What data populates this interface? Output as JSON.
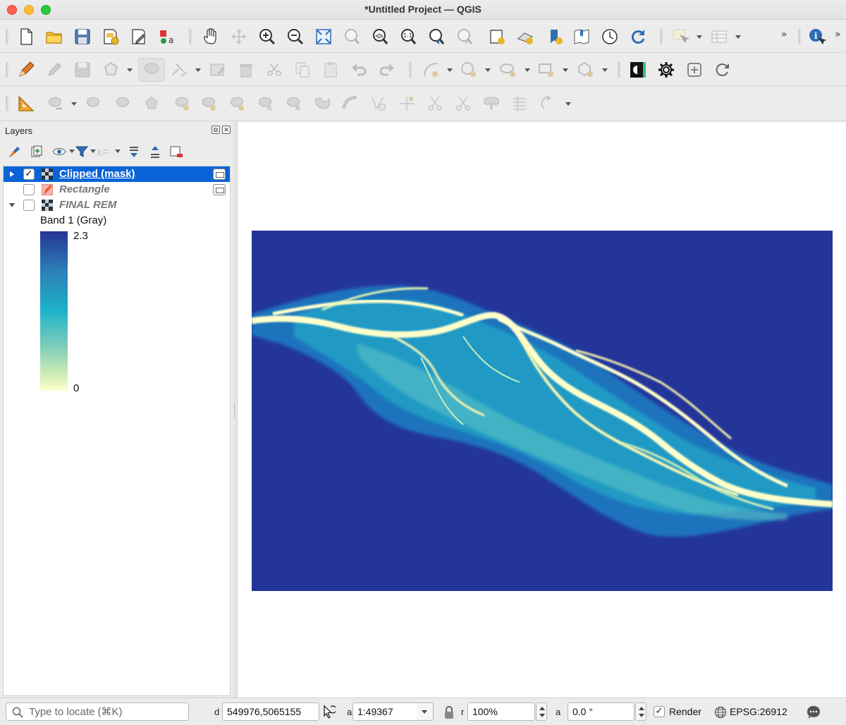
{
  "window": {
    "title": "*Untitled Project — QGIS"
  },
  "toolbars": {
    "overflow_label": "»",
    "icons": [
      "new-project-icon",
      "open-project-icon",
      "save-project-icon",
      "new-print-layout-icon",
      "layout-manager-icon",
      "style-manager-icon",
      "pan-icon",
      "pan-to-selection-icon",
      "zoom-in-icon",
      "zoom-out-icon",
      "zoom-full-icon",
      "zoom-to-selection-icon",
      "zoom-to-layer-icon",
      "zoom-native-icon",
      "zoom-last-icon",
      "zoom-next-icon",
      "new-map-view-icon",
      "new-3d-view-icon",
      "new-bookmark-icon",
      "show-bookmarks-icon",
      "temporal-controller-icon",
      "refresh-icon",
      "select-features-icon",
      "attribute-table-icon",
      "identify-icon"
    ]
  },
  "layers_panel": {
    "title": "Layers",
    "layers": [
      {
        "name": "Clipped (mask)",
        "checked": true,
        "selected": true,
        "expanded": false,
        "check_mark": "✓"
      },
      {
        "name": "Rectangle",
        "checked": false,
        "selected": false,
        "expanded": false,
        "check_mark": ""
      },
      {
        "name": "FINAL REM",
        "checked": false,
        "selected": false,
        "expanded": true,
        "check_mark": ""
      }
    ],
    "legend": {
      "band_label": "Band 1 (Gray)",
      "max": "2.3",
      "min": "0",
      "colors": [
        "#253494",
        "#2c7fb8",
        "#1db3c9",
        "#7fcdbb",
        "#c7e9b4",
        "#ffffcc"
      ]
    }
  },
  "map": {
    "background": "#ffffff",
    "raster_bg": "#24359a",
    "channel_color": "#ffffcc"
  },
  "statusbar": {
    "locator_placeholder": "Type to locate (⌘K)",
    "coordinate_label": "d",
    "coordinate": "549976,5065155",
    "scale_label": "a",
    "scale": "1:49367",
    "magnifier_label": "r",
    "magnifier": "100%",
    "rotation_label": "a",
    "rotation": "0.0 °",
    "render_label": "Render",
    "render_checked": "✓",
    "crs": "EPSG:26912"
  }
}
